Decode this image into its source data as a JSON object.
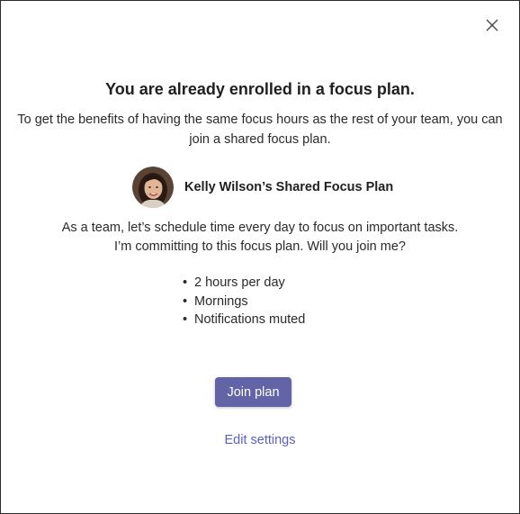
{
  "dialog": {
    "close_icon": "close-icon",
    "title": "You are already enrolled in a focus plan.",
    "subtitle_line1": "To get the benefits of having the same focus hours as the rest of your team, you can",
    "subtitle_line2": "join a shared focus plan.",
    "plan": {
      "avatar_icon": "person-avatar",
      "name": "Kelly Wilson’s Shared Focus Plan"
    },
    "message_line1": "As a team, let’s schedule time every day to focus on important tasks.",
    "message_line2": "I’m committing to this focus plan. Will you join me?",
    "details": [
      "2 hours per day",
      "Mornings",
      "Notifications muted"
    ],
    "join_label": "Join plan",
    "edit_label": "Edit settings"
  },
  "colors": {
    "accent": "#6264a7",
    "link": "#5b5fc7",
    "text": "#242424"
  }
}
